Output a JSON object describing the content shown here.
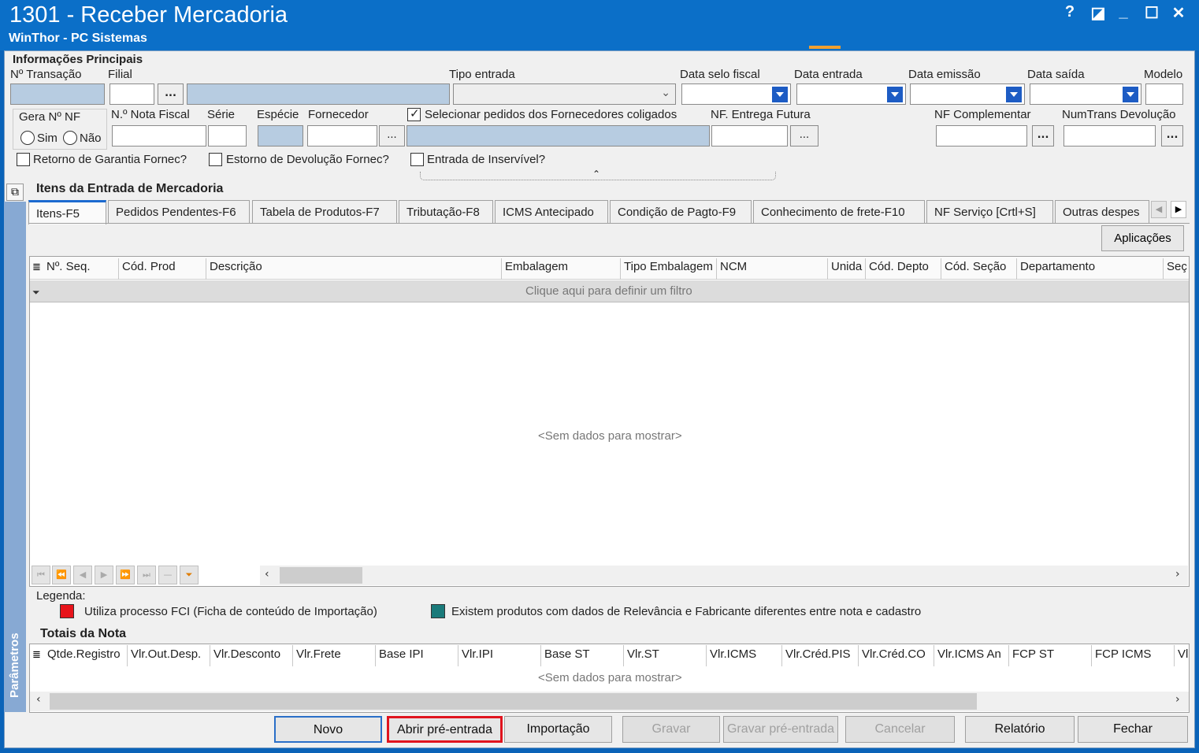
{
  "window": {
    "title": "1301 - Receber Mercadoria",
    "subtitle": "WinThor - PC Sistemas",
    "help": "?",
    "restore": "◪",
    "minimize": "_",
    "maximize": "☐",
    "close": "✕"
  },
  "header": {
    "section_title": "Informações Principais",
    "n_transacao": "Nº Transação",
    "filial": "Filial",
    "tipo_entrada": "Tipo entrada",
    "data_selo_fiscal": "Data selo fiscal",
    "data_entrada": "Data entrada",
    "data_emissao": "Data emissão",
    "data_saida": "Data saída",
    "modelo": "Modelo",
    "gera_nf": "Gera Nº NF",
    "sim": "Sim",
    "nao": "Não",
    "nota_fiscal": "N.º Nota Fiscal",
    "serie": "Série",
    "especie": "Espécie",
    "fornecedor": "Fornecedor",
    "selecionar_pedidos": "Selecionar pedidos dos Fornecedores coligados",
    "nf_entrega_futura": "NF. Entrega Futura",
    "nf_complementar": "NF Complementar",
    "numtrans_devolucao": "NumTrans Devolução",
    "retorno_garantia": "Retorno de Garantia Fornec?",
    "estorno_devolucao": "Estorno de Devolução Fornec?",
    "entrada_inservivel": "Entrada de Inservível?",
    "dots": "...",
    "dots_bold": "..."
  },
  "sidebar": {
    "label": "Parâmetros"
  },
  "items": {
    "section_title": "Itens da Entrada de Mercadoria",
    "tabs": [
      "Itens-F5",
      "Pedidos Pendentes-F6",
      "Tabela de Produtos-F7",
      "Tributação-F8",
      "ICMS Antecipado",
      "Condição de Pagto-F9",
      "Conhecimento de frete-F10",
      "NF Serviço [Crtl+S]",
      "Outras despes"
    ],
    "aplicacoes": "Aplicações",
    "columns": [
      "Nº. Seq.",
      "Cód. Prod",
      "Descrição",
      "Embalagem",
      "Tipo Embalagem",
      "NCM",
      "Unida",
      "Cód. Depto",
      "Cód. Seção",
      "Departamento",
      "Seç"
    ],
    "filter_text": "Clique aqui para definir um filtro",
    "empty": "<Sem dados para mostrar>"
  },
  "legend": {
    "title": "Legenda:",
    "fci": "Utiliza processo FCI (Ficha de conteúdo de Importação)",
    "relevancia": "Existem produtos com dados de Relevância e Fabricante diferentes entre nota e cadastro",
    "fci_color": "#e8141b",
    "relevancia_color": "#1a7a7a"
  },
  "totais": {
    "section_title": "Totais da Nota",
    "columns": [
      "Qtde.Registro",
      "Vlr.Out.Desp.",
      "Vlr.Desconto",
      "Vlr.Frete",
      "Base IPI",
      "Vlr.IPI",
      "Base ST",
      "Vlr.ST",
      "Vlr.ICMS",
      "Vlr.Créd.PIS",
      "Vlr.Créd.CO",
      "Vlr.ICMS An",
      "FCP ST",
      "FCP ICMS",
      "Vl"
    ],
    "empty": "<Sem dados para mostrar>"
  },
  "buttons": {
    "novo": "Novo",
    "abrir_pre_entrada": "Abrir pré-entrada",
    "importacao": "Importação",
    "gravar": "Gravar",
    "gravar_pre_entrada": "Gravar pré-entrada",
    "cancelar": "Cancelar",
    "relatorio": "Relatório",
    "fechar": "Fechar"
  }
}
